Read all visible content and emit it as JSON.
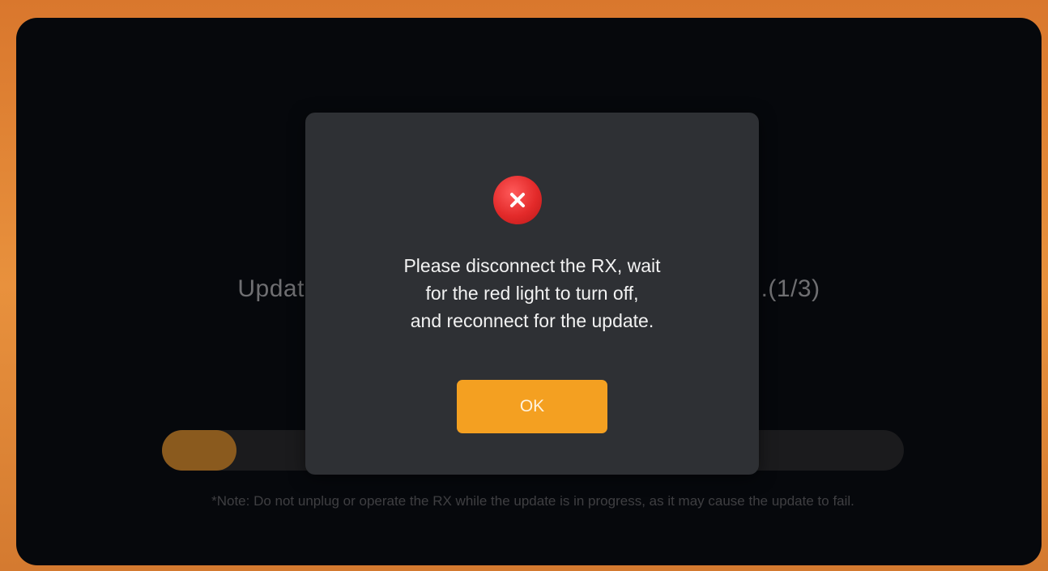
{
  "background": {
    "title_left": "Updat",
    "title_right": "...(1/3)",
    "progress": 0.1,
    "note": "*Note: Do not unplug or operate the RX while the update is in progress, as it may cause the update to fail."
  },
  "dialog": {
    "icon": "error-x-icon",
    "message_line1": "Please disconnect the RX, wait",
    "message_line2": "for the red light to turn off,",
    "message_line3": "and reconnect for the update.",
    "ok_label": "OK"
  },
  "colors": {
    "accent": "#f4a021",
    "error": "#e32a2a",
    "progress_fill": "#8a5a1e"
  }
}
